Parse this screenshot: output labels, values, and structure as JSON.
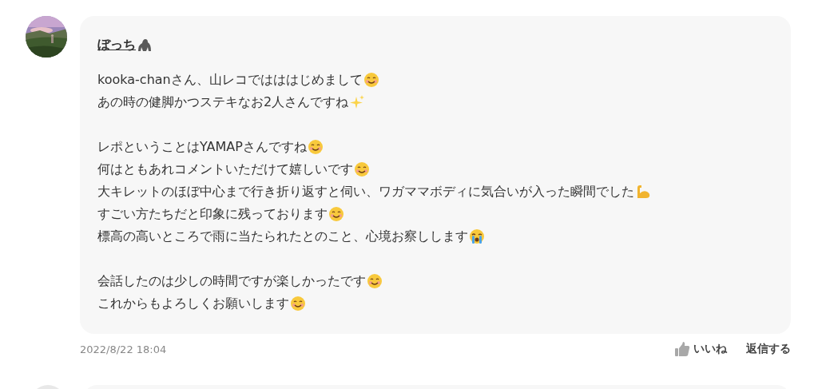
{
  "comment": {
    "author": {
      "name": "ぼっち",
      "kind": "gorilla"
    },
    "paragraphs": [
      [
        {
          "text": "kooka-chanさん、山レコではははじめまして",
          "kind": "smile"
        },
        {
          "text": "あの時の健脚かつステキなお2人さんですね",
          "kind": "sparkles"
        }
      ],
      [
        {
          "text": "レポということはYAMAPさんですね",
          "kind": "smile"
        },
        {
          "text": "何はともあれコメントいただけて嬉しいです",
          "kind": "smile"
        },
        {
          "text": "大キレットのほぼ中心まで行き折り返すと伺い、ワガママボディに気合いが入った瞬間でした",
          "kind": "muscle"
        },
        {
          "text": "すごい方たちだと印象に残っております",
          "kind": "smile"
        },
        {
          "text": "標高の高いところで雨に当たられたとのこと、心境お察しします",
          "kind": "crying"
        }
      ],
      [
        {
          "text": "会話したのは少しの時間ですが楽しかったです",
          "kind": "smile"
        },
        {
          "text": "これからもよろしくお願いします",
          "kind": "smile"
        }
      ]
    ],
    "date": "2022/8/22 18:04",
    "actions": {
      "like": "いいね",
      "reply": "返信する"
    }
  }
}
